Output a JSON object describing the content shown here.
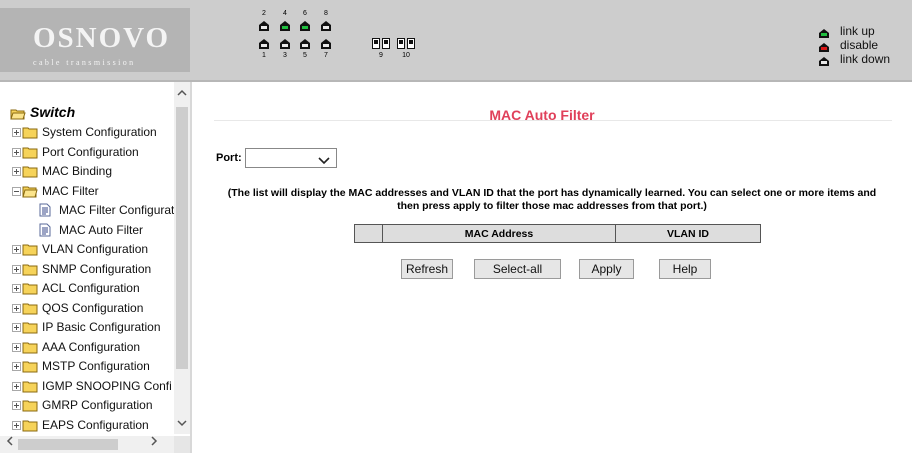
{
  "header": {
    "logo_title": "OSNOVO",
    "logo_subtitle": "cable transmission",
    "ports_top_numbers": [
      "2",
      "4",
      "6",
      "8"
    ],
    "ports_bottom_numbers": [
      "1",
      "3",
      "5",
      "7"
    ],
    "sfp_ports": [
      "9",
      "10"
    ],
    "port_status": {
      "1": "link-down",
      "2": "link-down",
      "3": "link-down",
      "4": "link-up",
      "5": "link-down",
      "6": "link-up",
      "7": "link-down",
      "8": "link-down",
      "9": "link-down",
      "10": "link-down"
    },
    "legend": [
      {
        "label": "link up",
        "color": "#20c040"
      },
      {
        "label": "disable",
        "color": "#d81818"
      },
      {
        "label": "link down",
        "color": "#222222"
      }
    ]
  },
  "sidebar": {
    "root_label": "Switch",
    "items": [
      {
        "label": "System Configuration",
        "expanded": false
      },
      {
        "label": "Port Configuration",
        "expanded": false
      },
      {
        "label": "MAC Binding",
        "expanded": false
      },
      {
        "label": "MAC Filter",
        "expanded": true,
        "children": [
          "MAC Filter Configurat",
          "MAC Auto Filter"
        ]
      },
      {
        "label": "VLAN Configuration",
        "expanded": false
      },
      {
        "label": "SNMP Configuration",
        "expanded": false
      },
      {
        "label": "ACL Configuration",
        "expanded": false
      },
      {
        "label": "QOS Configuration",
        "expanded": false
      },
      {
        "label": "IP Basic Configuration",
        "expanded": false
      },
      {
        "label": "AAA Configuration",
        "expanded": false
      },
      {
        "label": "MSTP Configuration",
        "expanded": false
      },
      {
        "label": "IGMP SNOOPING Confi",
        "expanded": false
      },
      {
        "label": "GMRP Configuration",
        "expanded": false
      },
      {
        "label": "EAPS Configuration",
        "expanded": false
      }
    ]
  },
  "main": {
    "title": "MAC Auto Filter",
    "port_label": "Port:",
    "port_value": "",
    "description_line1": "(The list will display the MAC addresses and VLAN ID that the port has dynamically learned. You can select one or more items and",
    "description_line2": "then press apply to filter those mac addresses from that port.)",
    "table_headers": [
      "",
      "MAC Address",
      "VLAN ID"
    ],
    "buttons": {
      "refresh": "Refresh",
      "select_all": "Select-all",
      "apply": "Apply",
      "help": "Help"
    }
  },
  "colors": {
    "title": "#e0405a",
    "link_up": "#20c040",
    "disable": "#d81818",
    "link_down": "#222222"
  }
}
